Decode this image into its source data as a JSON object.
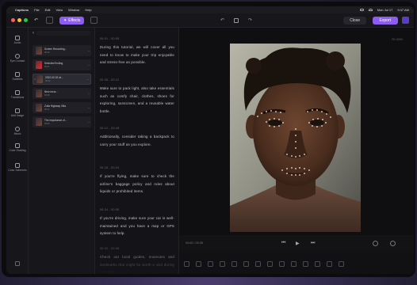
{
  "menubar": {
    "apple_glyph": "",
    "app_name": "Captions",
    "items": [
      "File",
      "Edit",
      "View",
      "Window",
      "Help"
    ],
    "clock_date": "Mon Jul 17",
    "clock_time": "9:47 AM"
  },
  "toolbar": {
    "back_glyph": "↶",
    "ai_label": "Effects",
    "ai_glyph": "✦",
    "undo_glyph": "↶",
    "redo_glyph": "↷",
    "close_label": "Close",
    "export_label": "Export",
    "colors": {
      "red": "#ff5f57",
      "yellow": "#febc2e",
      "green": "#28c840",
      "accent": "#8e5cf2"
    }
  },
  "rail": {
    "items": [
      "Audio",
      "Eye Contact",
      "Subtitles",
      "Transitions",
      "Add Image",
      "Music",
      "Color Grading",
      "Color Schemes"
    ]
  },
  "scenes": {
    "items": [
      {
        "num": "",
        "title": "Screen Recording...",
        "dur": "00:14",
        "thumb": "dark"
      },
      {
        "num": "",
        "title": "Selected Ending",
        "dur": "00:21",
        "thumb": "red"
      },
      {
        "num": "3",
        "title": "2022-02-02 at...",
        "dur": "00:42",
        "thumb": "dark",
        "active": true
      },
      {
        "num": "",
        "title": "New recor...",
        "dur": "00:38",
        "thumb": "dark"
      },
      {
        "num": "",
        "title": "Zoila Highway Villa",
        "dur": "00:17",
        "thumb": "dark"
      },
      {
        "num": "",
        "title": "The importance of...",
        "dur": "00:09",
        "thumb": "dark"
      }
    ]
  },
  "script": {
    "segments": [
      {
        "time": "00:01 - 00:05",
        "text": "During this tutorial, we will cover all you need to know to make your trip enjoyable and stress-free as possible."
      },
      {
        "time": "00:05 - 00:12",
        "text": "Make sure to pack light, also take essentials such as comfy chair, clothes, shoes for exploring, sunscreen, and a reusable water bottle."
      },
      {
        "time": "00:12 - 00:18",
        "text": "Additionally, consider taking a backpack to carry your stuff as you explore."
      },
      {
        "time": "00:18 - 00:24",
        "text": "If you're flying, make sure to check the airline's baggage policy and rules about liquids or prohibited items."
      },
      {
        "time": "00:24 - 00:30",
        "text": "If you're driving, make sure your car is well-maintained and you have a map or GPS system to help."
      },
      {
        "time": "00:30 - 00:36",
        "text": "Check out local guides, museums and landmarks that might be worth a visit during your stay."
      }
    ]
  },
  "preview": {
    "corner_label": "Fit 100%",
    "timecode": "00:00 / 00:35",
    "play_glyph": "▶",
    "prev_glyph": "⏮",
    "next_glyph": "⏭"
  }
}
